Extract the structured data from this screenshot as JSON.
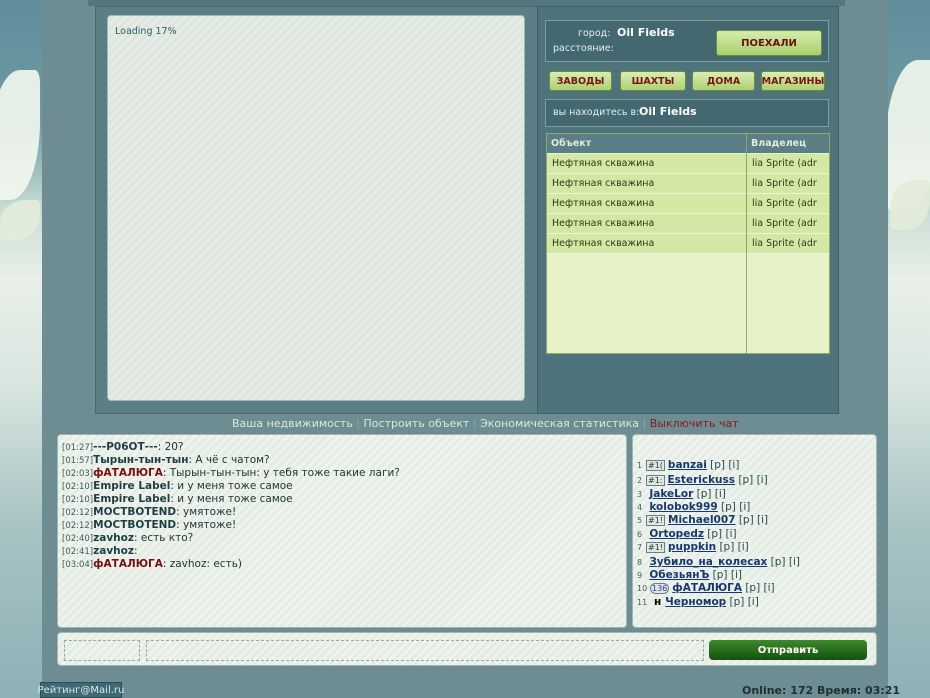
{
  "game": {
    "loading_text": "Loading 17%"
  },
  "city": {
    "city_label": "город:",
    "city_value": "Oil Fields",
    "distance_label": "расстояние:",
    "go_button": "ПОЕХАЛИ"
  },
  "nav": [
    "ЗАВОДЫ",
    "ШАХТЫ",
    "ДОМА",
    "МАГАЗИНЫ"
  ],
  "location": {
    "label": "вы находитесь в:",
    "value": "Oil Fields"
  },
  "objects_table": {
    "headers": [
      "Объект",
      "Владелец"
    ],
    "rows": [
      [
        "Нефтяная скважина",
        "lia Sprite (adr"
      ],
      [
        "Нефтяная скважина",
        "lia Sprite (adr"
      ],
      [
        "Нефтяная скважина",
        "lia Sprite (adr"
      ],
      [
        "Нефтяная скважина",
        "lia Sprite (adr"
      ],
      [
        "Нефтяная скважина",
        "lia Sprite (adr"
      ]
    ]
  },
  "links": {
    "property": "Ваша недвижимость",
    "build": "Построить объект",
    "stats": "Экономическая статистика",
    "chat_off": "Выключить чат",
    "sep": "|"
  },
  "chat": [
    {
      "time": "[01:27]",
      "user": "---Р06ОТ---",
      "text": ": 20?",
      "red": false
    },
    {
      "time": "[01:57]",
      "user": "Тырын-тын-тын",
      "text": ": А чё с чатом?",
      "red": false
    },
    {
      "time": "[02:03]",
      "user": "фАТАЛЮГА",
      "text": ": Тырын-тын-тын: у тебя тоже такие лаги?",
      "red": true
    },
    {
      "time": "[02:10]",
      "user": "Empire Label",
      "text": ": и у меня тоже самое",
      "red": false
    },
    {
      "time": "[02:10]",
      "user": "Empire Label",
      "text": ": и у меня тоже самое",
      "red": false
    },
    {
      "time": "[02:12]",
      "user": "МОСТВОТЕND",
      "text": ": умятоже!",
      "red": false
    },
    {
      "time": "[02:12]",
      "user": "МОСТВОТЕND",
      "text": ": умятоже!",
      "red": false
    },
    {
      "time": "[02:40]",
      "user": "zavhoz",
      "text": ": есть кто?",
      "red": false
    },
    {
      "time": "[02:41]",
      "user": "zavhoz",
      "text": ":",
      "red": false
    },
    {
      "time": "[03:04]",
      "user": "фАТАЛЮГА",
      "text": ": zavhoz: есть)",
      "red": true
    }
  ],
  "users": [
    {
      "n": "1",
      "badge": "#1(",
      "nick": "banzai"
    },
    {
      "n": "2",
      "badge": "#1:",
      "nick": "Esterickuss"
    },
    {
      "n": "3",
      "badge": "",
      "nick": "JakeLor"
    },
    {
      "n": "4",
      "badge": "",
      "nick": "kolobok999"
    },
    {
      "n": "5",
      "badge": "#1!",
      "nick": "Michael007"
    },
    {
      "n": "6",
      "badge": "",
      "nick": "Ortopedz"
    },
    {
      "n": "7",
      "badge": "#1!",
      "nick": "puppkin"
    },
    {
      "n": "8",
      "badge": "",
      "nick": "Зубило_на_колесах"
    },
    {
      "n": "9",
      "badge": "",
      "nick": "ОбезьянЪ"
    },
    {
      "n": "10",
      "badge": "136",
      "nick": "фАТАЛЮГА"
    },
    {
      "n": "11",
      "badge": "н",
      "nick": "Черномор"
    }
  ],
  "user_links": "[p] [i]",
  "send_button": "Отправить",
  "rating": "Рейтинг@Mail.ru",
  "status": "Online: 172  Время: 03:21"
}
